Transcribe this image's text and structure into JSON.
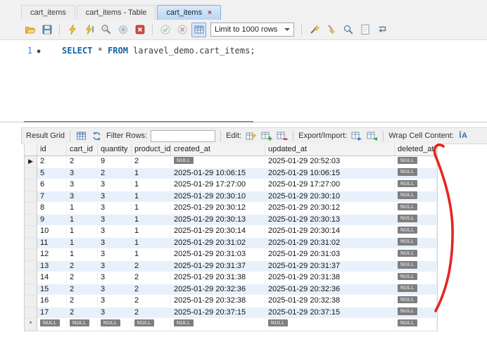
{
  "tabs": [
    {
      "label": "cart_items"
    },
    {
      "label": "cart_items - Table"
    },
    {
      "label": "cart_items",
      "close": "×"
    }
  ],
  "toolbar": {
    "limit_value": "Limit to 1000 rows",
    "icons": [
      "open-script",
      "save",
      "execute",
      "execute-current",
      "explain",
      "stop",
      "stop-on-error",
      "commit",
      "rollback",
      "limit-toggle",
      "beautify",
      "clean",
      "find",
      "invisible-chars",
      "wrap-text"
    ]
  },
  "editor": {
    "line_number": "1",
    "statement_marker": "●",
    "sql_select": "SELECT",
    "sql_star": " * ",
    "sql_from": "FROM",
    "sql_table": " laravel_demo.cart_items;"
  },
  "result_bar": {
    "title": "Result Grid",
    "filter_label": "Filter Rows:",
    "filter_value": "",
    "edit_label": "Edit:",
    "export_label": "Export/Import:",
    "wrap_label": "Wrap Cell Content:",
    "icons": [
      "result-grid",
      "refresh",
      "edit-record",
      "insert-record",
      "delete-record",
      "export",
      "import",
      "wrap-cell"
    ]
  },
  "grid": {
    "columns": [
      "id",
      "cart_id",
      "quantity",
      "product_id",
      "created_at",
      "updated_at",
      "deleted_at"
    ],
    "active_row_marker": "▶",
    "new_row_marker": "*",
    "rows": [
      [
        "2",
        "2",
        "9",
        "2",
        "NULL",
        "2025-01-29 20:52:03",
        "NULL"
      ],
      [
        "5",
        "3",
        "2",
        "1",
        "2025-01-29 10:06:15",
        "2025-01-29 10:06:15",
        "NULL"
      ],
      [
        "6",
        "3",
        "3",
        "1",
        "2025-01-29 17:27:00",
        "2025-01-29 17:27:00",
        "NULL"
      ],
      [
        "7",
        "3",
        "3",
        "1",
        "2025-01-29 20:30:10",
        "2025-01-29 20:30:10",
        "NULL"
      ],
      [
        "8",
        "1",
        "3",
        "1",
        "2025-01-29 20:30:12",
        "2025-01-29 20:30:12",
        "NULL"
      ],
      [
        "9",
        "1",
        "3",
        "1",
        "2025-01-29 20:30:13",
        "2025-01-29 20:30:13",
        "NULL"
      ],
      [
        "10",
        "1",
        "3",
        "1",
        "2025-01-29 20:30:14",
        "2025-01-29 20:30:14",
        "NULL"
      ],
      [
        "11",
        "1",
        "3",
        "1",
        "2025-01-29 20:31:02",
        "2025-01-29 20:31:02",
        "NULL"
      ],
      [
        "12",
        "1",
        "3",
        "1",
        "2025-01-29 20:31:03",
        "2025-01-29 20:31:03",
        "NULL"
      ],
      [
        "13",
        "2",
        "3",
        "2",
        "2025-01-29 20:31:37",
        "2025-01-29 20:31:37",
        "NULL"
      ],
      [
        "14",
        "2",
        "3",
        "2",
        "2025-01-29 20:31:38",
        "2025-01-29 20:31:38",
        "NULL"
      ],
      [
        "15",
        "2",
        "3",
        "2",
        "2025-01-29 20:32:36",
        "2025-01-29 20:32:36",
        "NULL"
      ],
      [
        "16",
        "2",
        "3",
        "2",
        "2025-01-29 20:32:38",
        "2025-01-29 20:32:38",
        "NULL"
      ],
      [
        "17",
        "2",
        "3",
        "2",
        "2025-01-29 20:37:15",
        "2025-01-29 20:37:15",
        "NULL"
      ]
    ],
    "new_row": [
      "NULL",
      "NULL",
      "NULL",
      "NULL",
      "NULL",
      "NULL",
      "NULL"
    ]
  },
  "annotation": {
    "type": "hand-drawn-red-curve",
    "color": "#e11a16"
  },
  "colors": {
    "active_tab": "#b9d6f2",
    "row_alt": "#e8f1fb",
    "null_badge": "#7e7e7e",
    "keyword": "#1464a0"
  }
}
